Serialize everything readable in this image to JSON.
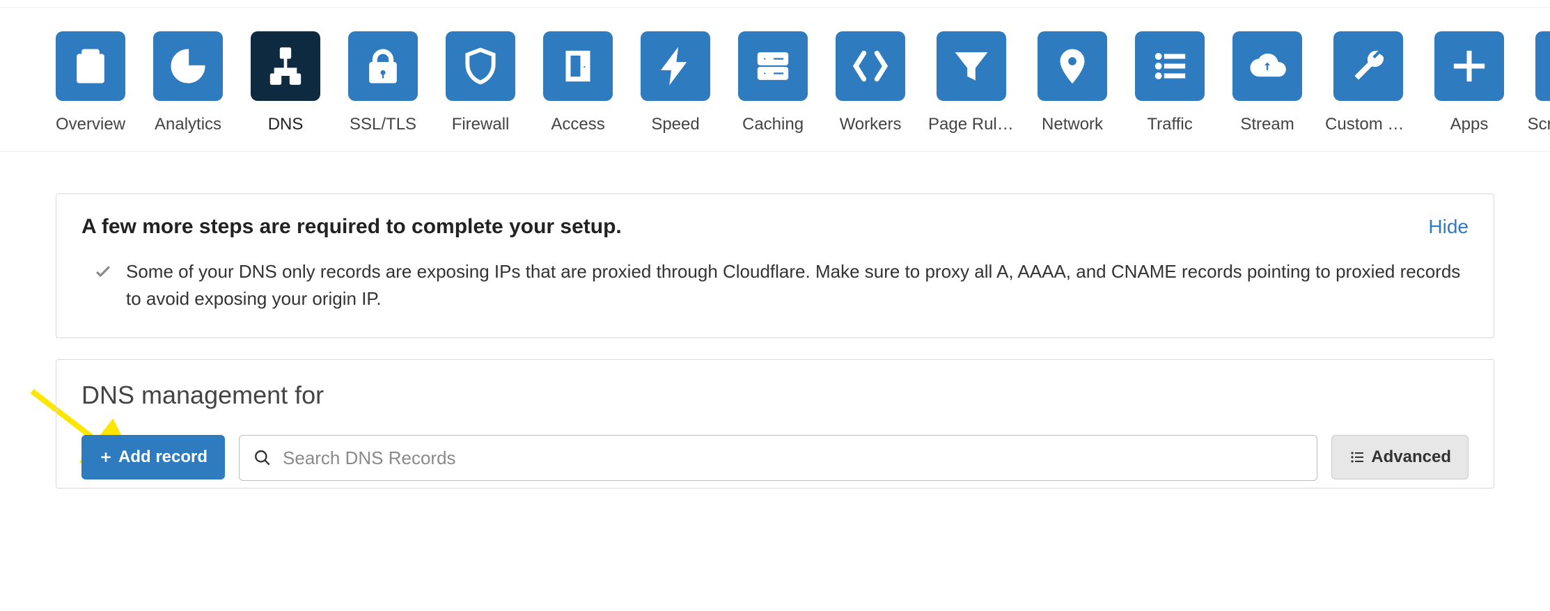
{
  "nav": {
    "items": [
      {
        "label": "Overview",
        "icon": "clipboard-icon"
      },
      {
        "label": "Analytics",
        "icon": "pie-icon"
      },
      {
        "label": "DNS",
        "icon": "sitemap-icon",
        "active": true
      },
      {
        "label": "SSL/TLS",
        "icon": "lock-icon"
      },
      {
        "label": "Firewall",
        "icon": "shield-icon"
      },
      {
        "label": "Access",
        "icon": "door-icon"
      },
      {
        "label": "Speed",
        "icon": "bolt-icon"
      },
      {
        "label": "Caching",
        "icon": "server-icon"
      },
      {
        "label": "Workers",
        "icon": "brackets-icon"
      },
      {
        "label": "Page Rules",
        "icon": "funnel-icon"
      },
      {
        "label": "Network",
        "icon": "pin-icon"
      },
      {
        "label": "Traffic",
        "icon": "list-icon"
      },
      {
        "label": "Stream",
        "icon": "cloud-icon"
      },
      {
        "label": "Custom P…",
        "icon": "wrench-icon"
      },
      {
        "label": "Apps",
        "icon": "plus-icon"
      },
      {
        "label": "Scrape S…",
        "icon": "file-icon"
      }
    ]
  },
  "setup_panel": {
    "title": "A few more steps are required to complete your setup.",
    "hide_label": "Hide",
    "message": "Some of your DNS only records are exposing IPs that are proxied through Cloudflare. Make sure to proxy all A, AAAA, and CNAME records pointing to proxied records to avoid exposing your origin IP."
  },
  "dns_panel": {
    "title": "DNS management for",
    "add_record_label": "Add record",
    "search_placeholder": "Search DNS Records",
    "advanced_label": "Advanced"
  },
  "colors": {
    "accent": "#2f7bbf",
    "accent_dark": "#0e2a40",
    "annotation": "#ffe600"
  }
}
